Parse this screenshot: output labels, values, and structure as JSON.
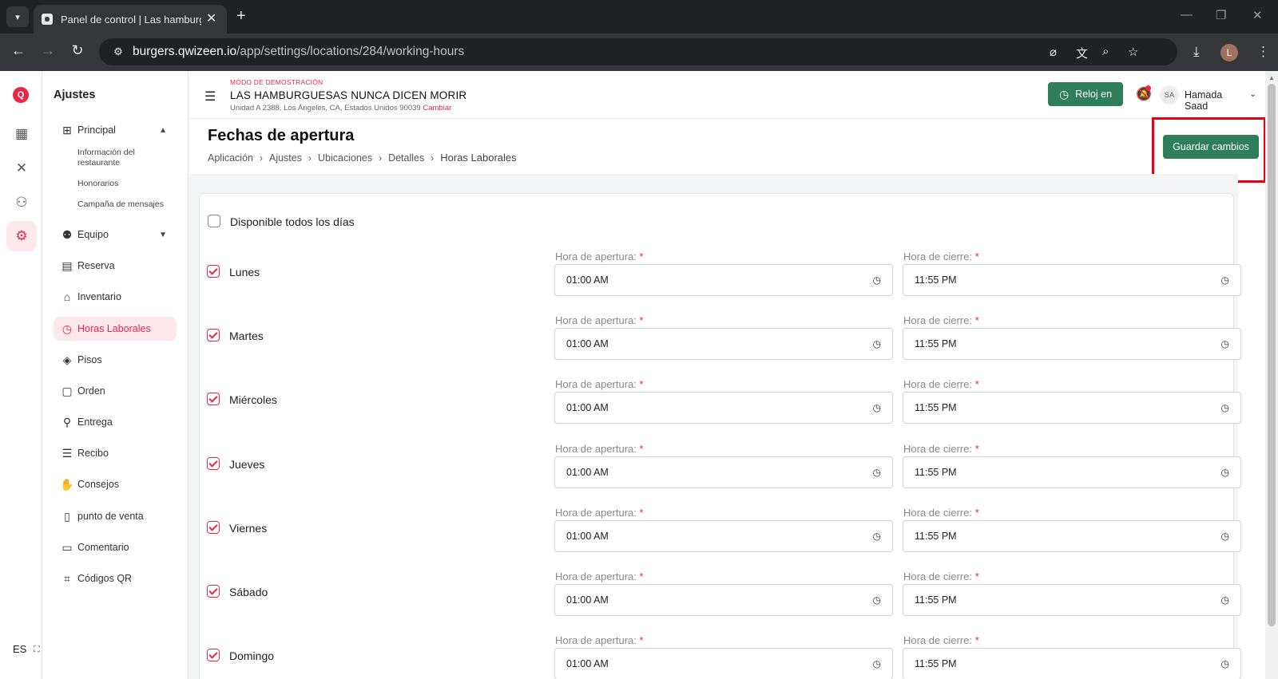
{
  "browser": {
    "tab_title": "Panel de control | Las hamburguesas",
    "url_host": "burgers.qwizeen.io",
    "url_path": "/app/settings/locations/284/working-hours",
    "profile_initial": "L"
  },
  "rail": {
    "logo": "Q",
    "language": "ES"
  },
  "sidebar": {
    "title": "Ajustes",
    "principal_label": "Principal",
    "sub_items": [
      "Información del restaurante",
      "Honorarios",
      "Campaña de mensajes"
    ],
    "items": [
      {
        "label": "Equipo",
        "icon": "team-icon"
      },
      {
        "label": "Reserva",
        "icon": "reservation-icon"
      },
      {
        "label": "Inventario",
        "icon": "inventory-icon"
      },
      {
        "label": "Horas Laborales",
        "icon": "calendar-clock-icon"
      },
      {
        "label": "Pisos",
        "icon": "layers-icon"
      },
      {
        "label": "Orden",
        "icon": "order-icon"
      },
      {
        "label": "Entrega",
        "icon": "delivery-icon"
      },
      {
        "label": "Recibo",
        "icon": "receipt-icon"
      },
      {
        "label": "Consejos",
        "icon": "tips-icon"
      },
      {
        "label": "punto de venta",
        "icon": "pos-icon"
      },
      {
        "label": "Comentario",
        "icon": "comment-icon"
      },
      {
        "label": "Códigos QR",
        "icon": "qr-icon"
      }
    ]
  },
  "header": {
    "demo_mode": "MODO DE DEMOSTRACIÓN",
    "restaurant_name": "LAS HAMBURGUESAS NUNCA DICEN MORIR",
    "address": "Unidad A 2388, Los Ángeles, CA, Estados Unidos 90039",
    "change_label": "Cambiar",
    "clock_in_label": "Reloj en",
    "user_initials": "SA",
    "user_name": "Hamada Saad"
  },
  "page": {
    "title": "Fechas de apertura",
    "breadcrumbs": [
      "Aplicación",
      "Ajustes",
      "Ubicaciones",
      "Detalles",
      "Horas Laborales"
    ],
    "save_label": "Guardar cambios"
  },
  "form": {
    "all_days_label": "Disponible todos los días",
    "all_days_checked": false,
    "open_label": "Hora de apertura:",
    "close_label": "Hora de cierre:",
    "required_mark": "*",
    "days": [
      {
        "name": "Lunes",
        "checked": true,
        "open": "01:00 AM",
        "close": "11:55 PM"
      },
      {
        "name": "Martes",
        "checked": true,
        "open": "01:00 AM",
        "close": "11:55 PM"
      },
      {
        "name": "Miércoles",
        "checked": true,
        "open": "01:00 AM",
        "close": "11:55 PM"
      },
      {
        "name": "Jueves",
        "checked": true,
        "open": "01:00 AM",
        "close": "11:55 PM"
      },
      {
        "name": "Viernes",
        "checked": true,
        "open": "01:00 AM",
        "close": "11:55 PM"
      },
      {
        "name": "Sábado",
        "checked": true,
        "open": "01:00 AM",
        "close": "11:55 PM"
      },
      {
        "name": "Domingo",
        "checked": true,
        "open": "01:00 AM",
        "close": "11:55 PM"
      }
    ]
  },
  "colors": {
    "accent": "#e8264b",
    "primary_button": "#2e7d5b",
    "highlight_box": "#e60012"
  }
}
